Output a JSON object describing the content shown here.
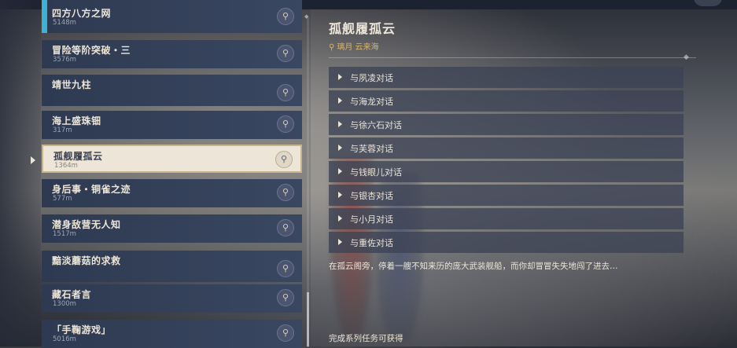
{
  "quest_list": [
    {
      "name": "四方八方之网",
      "distance": "5148m",
      "tracked": true
    },
    {
      "name": "冒险等阶突破・三",
      "distance": "3576m"
    },
    {
      "name": "靖世九柱",
      "distance": ""
    },
    {
      "name": "海上盛珠钿",
      "distance": "317m"
    },
    {
      "name": "孤舰履孤云",
      "distance": "1364m",
      "selected": true
    },
    {
      "name": "身后事・铜雀之迹",
      "distance": "577m"
    },
    {
      "name": "潜身敌营无人知",
      "distance": "1517m"
    },
    {
      "name": "黯淡蘑菇的求救",
      "distance": ""
    },
    {
      "name": "藏石者言",
      "distance": "1300m"
    },
    {
      "name": "「手鞠游戏」",
      "distance": "5016m"
    }
  ],
  "detail": {
    "title": "孤舰履孤云",
    "location": "璃月 云来海",
    "objectives": [
      "与夙凌对话",
      "与海龙对话",
      "与徐六石对话",
      "与芙蓉对话",
      "与钱眼儿对话",
      "与银杏对话",
      "与小月对话",
      "与重佐对话"
    ],
    "description": "在孤云阁旁，停着一艘不知来历的庞大武装舰船，而你却冒冒失失地闯了进去…",
    "reward_note": "完成系列任务可获得"
  },
  "icons": {
    "pin": "map-pin-icon",
    "location": "location-marker-icon",
    "objective": "triangle-right-icon"
  },
  "colors": {
    "accent_cyan": "#3eb1d6",
    "location_gold": "#d9b56a",
    "selected_bg": "#ece5d8",
    "text_light": "#ece5d8"
  }
}
